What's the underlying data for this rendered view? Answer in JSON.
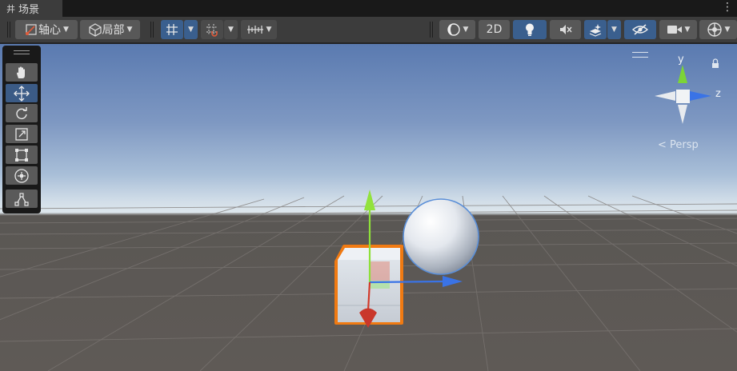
{
  "window": {
    "tab_icon": "grid-hash-icon",
    "tab_title": "场景",
    "menu_icon": "kebab-menu-icon"
  },
  "toolbar": {
    "pivot_label": "轴心",
    "space_label": "局部",
    "mode_2d_label": "2D",
    "icons": [
      "pivot-icon",
      "local-cube-icon",
      "grid-snap-icon",
      "increment-snap-icon",
      "ruler-icon",
      "shading-mode-icon",
      "lighting-icon",
      "audio-mute-icon",
      "effects-icon",
      "visibility-icon",
      "camera-icon",
      "gizmos-icon"
    ]
  },
  "tools": {
    "items": [
      "hand-tool",
      "move-tool",
      "rotate-tool",
      "scale-tool",
      "rect-tool",
      "transform-tool",
      "custom-tool"
    ],
    "active": "move-tool"
  },
  "gizmo": {
    "y_label": "y",
    "z_label": "z",
    "projection_label": "< Persp"
  },
  "colors": {
    "accent": "#3a5f8e",
    "selection_outline": "#f07a12",
    "axis_x": "#d23a2a",
    "axis_y": "#8ee03a",
    "axis_z": "#3a73e6"
  }
}
